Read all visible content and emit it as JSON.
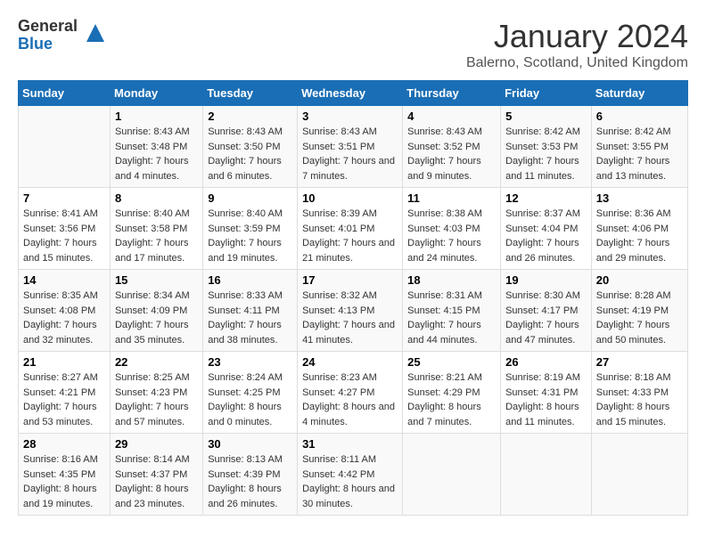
{
  "logo": {
    "general": "General",
    "blue": "Blue"
  },
  "title": "January 2024",
  "subtitle": "Balerno, Scotland, United Kingdom",
  "days_header": [
    "Sunday",
    "Monday",
    "Tuesday",
    "Wednesday",
    "Thursday",
    "Friday",
    "Saturday"
  ],
  "weeks": [
    [
      {
        "num": "",
        "sunrise": "",
        "sunset": "",
        "daylight": ""
      },
      {
        "num": "1",
        "sunrise": "Sunrise: 8:43 AM",
        "sunset": "Sunset: 3:48 PM",
        "daylight": "Daylight: 7 hours and 4 minutes."
      },
      {
        "num": "2",
        "sunrise": "Sunrise: 8:43 AM",
        "sunset": "Sunset: 3:50 PM",
        "daylight": "Daylight: 7 hours and 6 minutes."
      },
      {
        "num": "3",
        "sunrise": "Sunrise: 8:43 AM",
        "sunset": "Sunset: 3:51 PM",
        "daylight": "Daylight: 7 hours and 7 minutes."
      },
      {
        "num": "4",
        "sunrise": "Sunrise: 8:43 AM",
        "sunset": "Sunset: 3:52 PM",
        "daylight": "Daylight: 7 hours and 9 minutes."
      },
      {
        "num": "5",
        "sunrise": "Sunrise: 8:42 AM",
        "sunset": "Sunset: 3:53 PM",
        "daylight": "Daylight: 7 hours and 11 minutes."
      },
      {
        "num": "6",
        "sunrise": "Sunrise: 8:42 AM",
        "sunset": "Sunset: 3:55 PM",
        "daylight": "Daylight: 7 hours and 13 minutes."
      }
    ],
    [
      {
        "num": "7",
        "sunrise": "Sunrise: 8:41 AM",
        "sunset": "Sunset: 3:56 PM",
        "daylight": "Daylight: 7 hours and 15 minutes."
      },
      {
        "num": "8",
        "sunrise": "Sunrise: 8:40 AM",
        "sunset": "Sunset: 3:58 PM",
        "daylight": "Daylight: 7 hours and 17 minutes."
      },
      {
        "num": "9",
        "sunrise": "Sunrise: 8:40 AM",
        "sunset": "Sunset: 3:59 PM",
        "daylight": "Daylight: 7 hours and 19 minutes."
      },
      {
        "num": "10",
        "sunrise": "Sunrise: 8:39 AM",
        "sunset": "Sunset: 4:01 PM",
        "daylight": "Daylight: 7 hours and 21 minutes."
      },
      {
        "num": "11",
        "sunrise": "Sunrise: 8:38 AM",
        "sunset": "Sunset: 4:03 PM",
        "daylight": "Daylight: 7 hours and 24 minutes."
      },
      {
        "num": "12",
        "sunrise": "Sunrise: 8:37 AM",
        "sunset": "Sunset: 4:04 PM",
        "daylight": "Daylight: 7 hours and 26 minutes."
      },
      {
        "num": "13",
        "sunrise": "Sunrise: 8:36 AM",
        "sunset": "Sunset: 4:06 PM",
        "daylight": "Daylight: 7 hours and 29 minutes."
      }
    ],
    [
      {
        "num": "14",
        "sunrise": "Sunrise: 8:35 AM",
        "sunset": "Sunset: 4:08 PM",
        "daylight": "Daylight: 7 hours and 32 minutes."
      },
      {
        "num": "15",
        "sunrise": "Sunrise: 8:34 AM",
        "sunset": "Sunset: 4:09 PM",
        "daylight": "Daylight: 7 hours and 35 minutes."
      },
      {
        "num": "16",
        "sunrise": "Sunrise: 8:33 AM",
        "sunset": "Sunset: 4:11 PM",
        "daylight": "Daylight: 7 hours and 38 minutes."
      },
      {
        "num": "17",
        "sunrise": "Sunrise: 8:32 AM",
        "sunset": "Sunset: 4:13 PM",
        "daylight": "Daylight: 7 hours and 41 minutes."
      },
      {
        "num": "18",
        "sunrise": "Sunrise: 8:31 AM",
        "sunset": "Sunset: 4:15 PM",
        "daylight": "Daylight: 7 hours and 44 minutes."
      },
      {
        "num": "19",
        "sunrise": "Sunrise: 8:30 AM",
        "sunset": "Sunset: 4:17 PM",
        "daylight": "Daylight: 7 hours and 47 minutes."
      },
      {
        "num": "20",
        "sunrise": "Sunrise: 8:28 AM",
        "sunset": "Sunset: 4:19 PM",
        "daylight": "Daylight: 7 hours and 50 minutes."
      }
    ],
    [
      {
        "num": "21",
        "sunrise": "Sunrise: 8:27 AM",
        "sunset": "Sunset: 4:21 PM",
        "daylight": "Daylight: 7 hours and 53 minutes."
      },
      {
        "num": "22",
        "sunrise": "Sunrise: 8:25 AM",
        "sunset": "Sunset: 4:23 PM",
        "daylight": "Daylight: 7 hours and 57 minutes."
      },
      {
        "num": "23",
        "sunrise": "Sunrise: 8:24 AM",
        "sunset": "Sunset: 4:25 PM",
        "daylight": "Daylight: 8 hours and 0 minutes."
      },
      {
        "num": "24",
        "sunrise": "Sunrise: 8:23 AM",
        "sunset": "Sunset: 4:27 PM",
        "daylight": "Daylight: 8 hours and 4 minutes."
      },
      {
        "num": "25",
        "sunrise": "Sunrise: 8:21 AM",
        "sunset": "Sunset: 4:29 PM",
        "daylight": "Daylight: 8 hours and 7 minutes."
      },
      {
        "num": "26",
        "sunrise": "Sunrise: 8:19 AM",
        "sunset": "Sunset: 4:31 PM",
        "daylight": "Daylight: 8 hours and 11 minutes."
      },
      {
        "num": "27",
        "sunrise": "Sunrise: 8:18 AM",
        "sunset": "Sunset: 4:33 PM",
        "daylight": "Daylight: 8 hours and 15 minutes."
      }
    ],
    [
      {
        "num": "28",
        "sunrise": "Sunrise: 8:16 AM",
        "sunset": "Sunset: 4:35 PM",
        "daylight": "Daylight: 8 hours and 19 minutes."
      },
      {
        "num": "29",
        "sunrise": "Sunrise: 8:14 AM",
        "sunset": "Sunset: 4:37 PM",
        "daylight": "Daylight: 8 hours and 23 minutes."
      },
      {
        "num": "30",
        "sunrise": "Sunrise: 8:13 AM",
        "sunset": "Sunset: 4:39 PM",
        "daylight": "Daylight: 8 hours and 26 minutes."
      },
      {
        "num": "31",
        "sunrise": "Sunrise: 8:11 AM",
        "sunset": "Sunset: 4:42 PM",
        "daylight": "Daylight: 8 hours and 30 minutes."
      },
      {
        "num": "",
        "sunrise": "",
        "sunset": "",
        "daylight": ""
      },
      {
        "num": "",
        "sunrise": "",
        "sunset": "",
        "daylight": ""
      },
      {
        "num": "",
        "sunrise": "",
        "sunset": "",
        "daylight": ""
      }
    ]
  ]
}
